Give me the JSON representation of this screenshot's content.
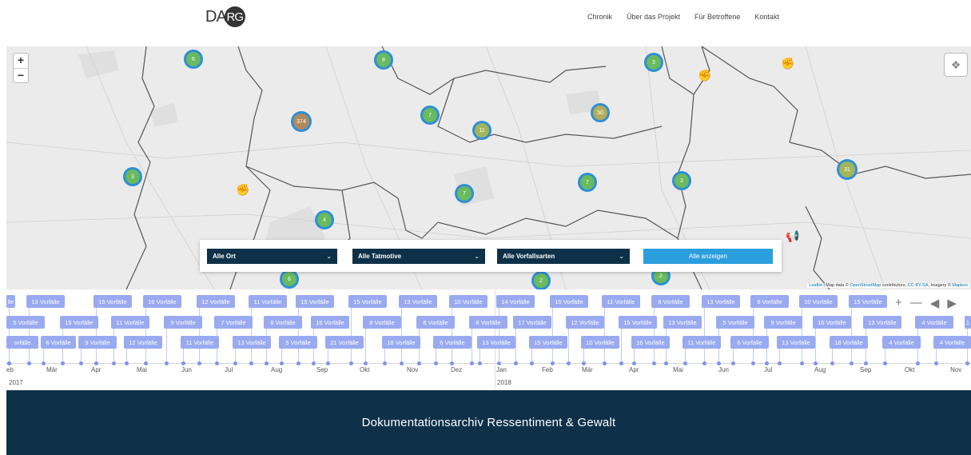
{
  "header": {
    "logo_text": "DA",
    "logo_circle": "RG",
    "nav": [
      "Chronik",
      "Über das Projekt",
      "Für Betroffene",
      "Kontakt"
    ]
  },
  "map": {
    "zoom_in": "+",
    "zoom_out": "−",
    "layers_icon": "layers-icon",
    "clusters": [
      {
        "count": "6",
        "color": "#6aba5f"
      },
      {
        "count": "8",
        "color": "#6aba5f"
      },
      {
        "count": "3",
        "color": "#6aba5f"
      },
      {
        "count": "374",
        "color": "#b08a5c"
      },
      {
        "count": "7",
        "color": "#6aba5f"
      },
      {
        "count": "11",
        "color": "#a3b55a"
      },
      {
        "count": "50",
        "color": "#b3ad58"
      },
      {
        "count": "3",
        "color": "#6aba5f"
      },
      {
        "count": "31",
        "color": "#a3b55a"
      },
      {
        "count": "7",
        "color": "#6aba5f"
      },
      {
        "count": "7",
        "color": "#6aba5f"
      },
      {
        "count": "3",
        "color": "#6aba5f"
      },
      {
        "count": "4",
        "color": "#6aba5f"
      },
      {
        "count": "6",
        "color": "#6aba5f"
      },
      {
        "count": "2",
        "color": "#6aba5f"
      },
      {
        "count": "2",
        "color": "#6aba5f"
      }
    ],
    "attribution": {
      "leaflet": "Leaflet",
      "text1": " | Map data © ",
      "osm": "OpenStreetMap",
      "text2": " contributors, ",
      "cc": "CC-BY-SA",
      "text3": ", Imagery © ",
      "mapbox": "Mapbox"
    }
  },
  "filters": {
    "ort": "Alle Ort",
    "tatmotive": "Alle Tatmotive",
    "vorfallsarten": "Alle Vorfallsarten",
    "show_all": "Alle anzeigen"
  },
  "timeline": {
    "row1": [
      "lle",
      "13 Vorfälle",
      "15 Vorfälle",
      "16 Vorfälle",
      "12 Vorfälle",
      "11 Vorfälle",
      "15 Vorfälle",
      "15 Vorfälle",
      "13 Vorfälle",
      "10 Vorfälle",
      "14 Vorfälle",
      "15 Vorfälle",
      "11 Vorfälle",
      "8 Vorfälle",
      "13 Vorfälle",
      "8 Vorfälle",
      "10 Vorfälle",
      "15 Vorfälle"
    ],
    "row2": [
      "5 Vorfälle",
      "15 Vorfälle",
      "11 Vorfälle",
      "9 Vorfälle",
      "7 Vorfälle",
      "6 Vorfälle",
      "16 Vorfälle",
      "8 Vorfälle",
      "8 Vorfälle",
      "6 Vorfälle",
      "17 Vorfälle",
      "12 Vorfälle",
      "15 Vorfälle",
      "13 Vorfälle",
      "5 Vorfälle",
      "9 Vorfälle",
      "16 Vorfälle",
      "13 Vorfälle",
      "4 Vorfälle",
      "1"
    ],
    "row3": [
      "orfälle",
      "6 Vorfälle",
      "9 Vorfälle",
      "12 Vorfälle",
      "11 Vorfälle",
      "13 Vorfälle",
      "5 Vorfälle",
      "21 Vorfälle",
      "18 Vorfälle",
      "6 Vorfälle",
      "13 Vorfälle",
      "15 Vorfälle",
      "10 Vorfälle",
      "16 Vorfälle",
      "11 Vorfälle",
      "6 Vorfälle",
      "13 Vorfälle",
      "18 Vorfälle",
      "4 Vorfälle",
      "4 Vorfälle"
    ],
    "months": [
      "eb",
      "Mär",
      "Apr",
      "Mai",
      "Jun",
      "Jul",
      "Aug",
      "Sep",
      "Okt",
      "Nov",
      "Dez",
      "Jan",
      "Feb",
      "Mär",
      "Apr",
      "Mai",
      "Jun",
      "Jul",
      "Aug",
      "Sep",
      "Okt",
      "Nov"
    ],
    "years": [
      "2017",
      "2018"
    ],
    "controls": {
      "zoom_in": "+",
      "zoom_out": "—",
      "prev": "◀",
      "next": "▶"
    }
  },
  "footer": {
    "title": "Dokumentationsarchiv Ressentiment & Gewalt"
  }
}
